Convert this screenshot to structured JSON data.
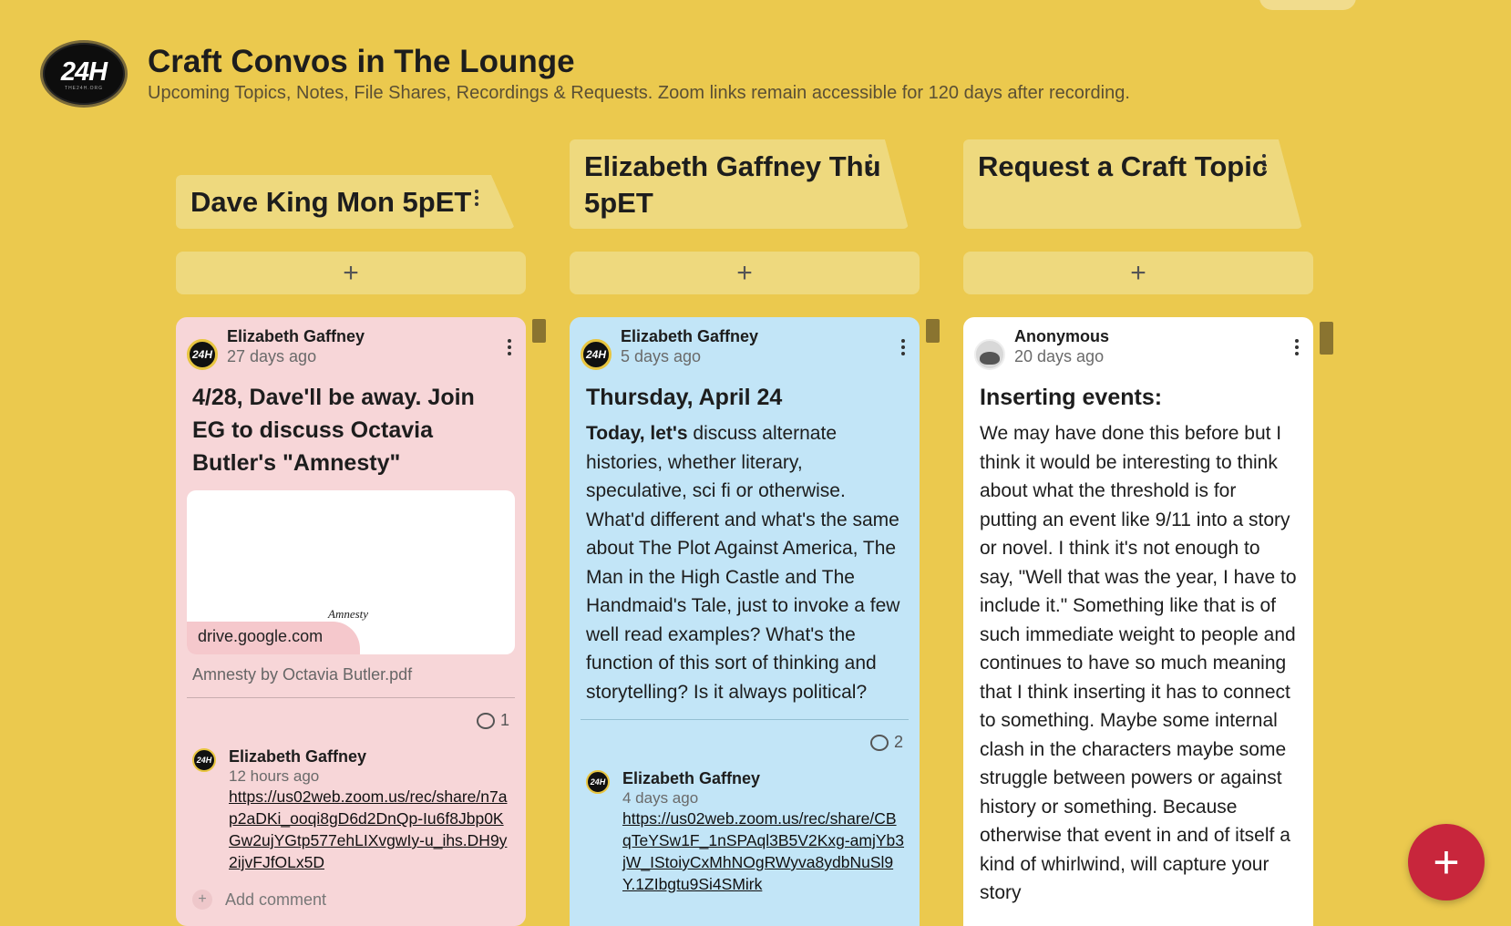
{
  "board": {
    "logo_text": "24H",
    "logo_sub": "THE24H.ORG",
    "title": "Craft Convos in The Lounge",
    "subtitle": "Upcoming Topics, Notes, File Shares, Recordings & Requests. Zoom links remain accessible for 120 days after recording."
  },
  "columns": [
    {
      "title": "Dave King Mon 5pET",
      "add_label": "+",
      "post": {
        "author": "Elizabeth Gaffney",
        "time": "27 days ago",
        "title": "4/28, Dave'll be away. Join EG to discuss Octavia Butler's \"Amnesty\"",
        "attachment_doc_title": "Amnesty",
        "attachment_domain": "drive.google.com",
        "attachment_caption": "Amnesty by Octavia Butler.pdf",
        "comment_count": "1",
        "comments": [
          {
            "author": "Elizabeth Gaffney",
            "time": "12 hours ago",
            "link": "https://us02web.zoom.us/rec/share/n7ap2aDKi_ooqi8gD6d2DnQp-Iu6f8Jbp0KGw2ujYGtp577ehLIXvgwIy-u_ihs.DH9y2ijvFJfOLx5D"
          }
        ],
        "add_comment": "Add comment"
      }
    },
    {
      "title": "Elizabeth Gaffney Thu 5pET",
      "add_label": "+",
      "post": {
        "author": "Elizabeth Gaffney",
        "time": "5 days ago",
        "title": "Thursday, April 24",
        "body_bold": "Today, let's",
        "body": " discuss alternate histories, whether literary, speculative, sci fi or otherwise. What'd different and what's the same about The Plot Against America, The Man in the High Castle and The Handmaid's Tale, just to invoke a few well read examples? What's the function of this sort of thinking and storytelling? Is it always political?",
        "comment_count": "2",
        "comments": [
          {
            "author": "Elizabeth Gaffney",
            "time": "4 days ago",
            "link": "https://us02web.zoom.us/rec/share/CBqTeYSw1F_1nSPAql3B5V2Kxg-amjYb3jW_IStoiyCxMhNOgRWyva8ydbNuSl9Y.1ZIbgtu9Si4SMirk"
          }
        ]
      }
    },
    {
      "title": "Request a Craft Topic",
      "add_label": "+",
      "post": {
        "author": "Anonymous",
        "time": "20 days ago",
        "title": "Inserting events:",
        "body": "We may have done this before but I think it would be interesting to think about what the threshold is for putting an event like 9/11 into a story or novel. I think it's not enough to say, \"Well that was the year, I have to include it.\" Something like that is of such immediate weight to people and continues to have so much meaning that I think inserting it has to connect to something. Maybe some internal clash in the characters maybe some struggle between powers or against history or something. Because otherwise that event in and of itself a kind of whirlwind, will capture your story"
      }
    }
  ],
  "fab_label": "+",
  "icons": {
    "menu": "vertical-dots-icon",
    "comment": "comment-bubble-icon",
    "add": "plus-icon"
  },
  "colors": {
    "background": "#ebc94e",
    "column_header": "#eed97e",
    "card_pink": "#f7d6d8",
    "card_blue": "#c2e5f7",
    "card_white": "#ffffff",
    "fab": "#c8263c"
  }
}
